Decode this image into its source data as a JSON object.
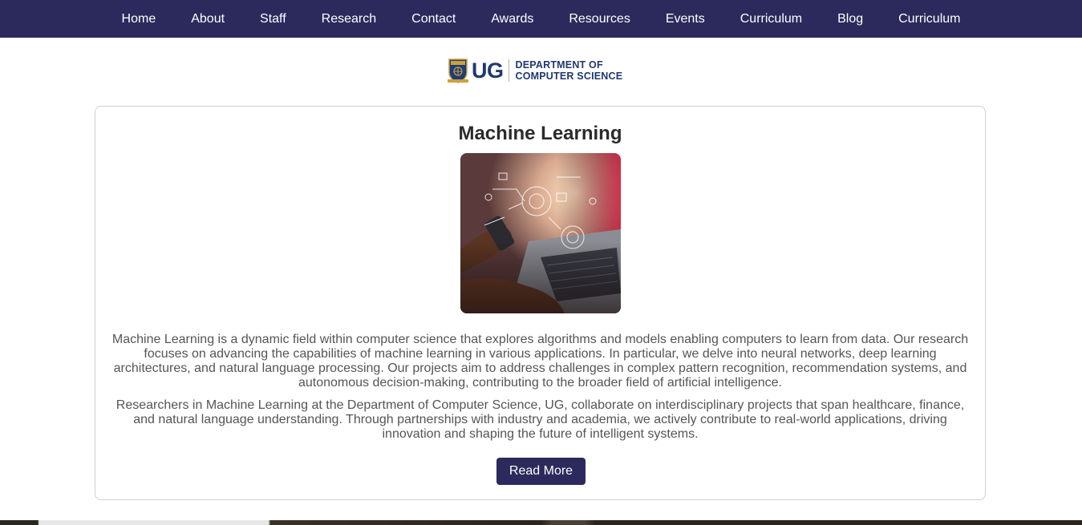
{
  "nav": {
    "items": [
      {
        "label": "Home"
      },
      {
        "label": "About"
      },
      {
        "label": "Staff"
      },
      {
        "label": "Research"
      },
      {
        "label": "Contact"
      },
      {
        "label": "Awards"
      },
      {
        "label": "Resources"
      },
      {
        "label": "Events"
      },
      {
        "label": "Curriculum"
      },
      {
        "label": "Blog"
      },
      {
        "label": "Curriculum"
      }
    ]
  },
  "logo": {
    "ug": "UG",
    "line1": "DEPARTMENT OF",
    "line2": "COMPUTER SCIENCE"
  },
  "card": {
    "title": "Machine Learning",
    "paragraphs": [
      "Machine Learning is a dynamic field within computer science that explores algorithms and models enabling computers to learn from data. Our research focuses on advancing the capabilities of machine learning in various applications. In particular, we delve into neural networks, deep learning architectures, and natural language processing. Our projects aim to address challenges in complex pattern recognition, recommendation systems, and autonomous decision-making, contributing to the broader field of artificial intelligence.",
      "Researchers in Machine Learning at the Department of Computer Science, UG, collaborate on interdisciplinary projects that span healthcare, finance, and natural language understanding. Through partnerships with industry and academia, we actively contribute to real-world applications, driving innovation and shaping the future of intelligent systems."
    ],
    "button_label": "Read More"
  },
  "colors": {
    "nav_bg": "#2c2a5c",
    "brand_blue": "#20386f",
    "button_bg": "#2c2a5c"
  }
}
